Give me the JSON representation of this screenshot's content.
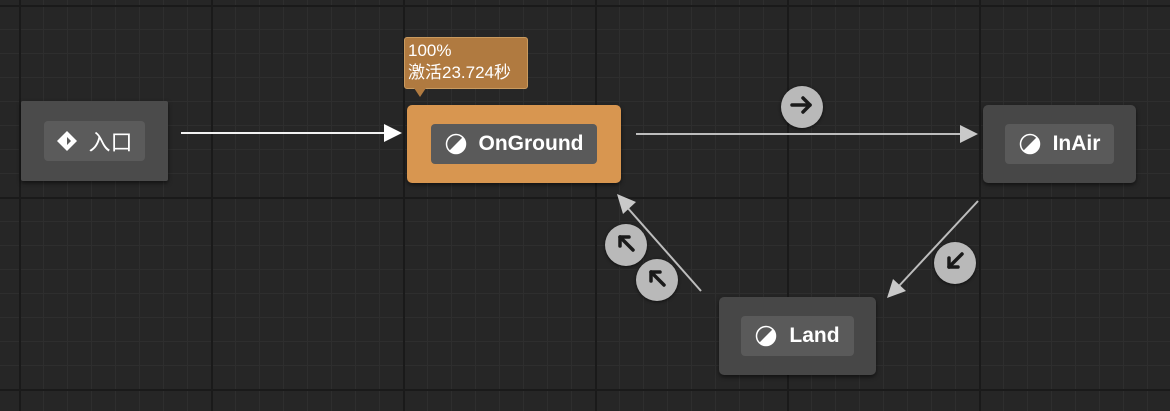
{
  "graph": {
    "entry_node": {
      "label": "入口",
      "icon": "entry-diamond-icon"
    },
    "states": [
      {
        "id": "onground",
        "label": "OnGround",
        "icon": "state-icon",
        "active": true
      },
      {
        "id": "inair",
        "label": "InAir",
        "icon": "state-icon",
        "active": false
      },
      {
        "id": "land",
        "label": "Land",
        "icon": "state-icon",
        "active": false
      }
    ],
    "active_tooltip": {
      "weight": "100%",
      "duration": "激活23.724秒"
    },
    "transitions": [
      {
        "from": "onground",
        "to": "inair",
        "icon": "arrow-right-icon"
      },
      {
        "from": "inair",
        "to": "land",
        "icon": "arrow-down-left-icon"
      },
      {
        "from": "land",
        "to": "onground",
        "icon": "arrow-up-left-icon"
      },
      {
        "from": "land",
        "to": "onground",
        "icon": "arrow-up-left-icon"
      }
    ]
  },
  "colors": {
    "background": "#262626",
    "active_state": "#d89650",
    "state_node": "#474747",
    "tooltip": "#b07a40",
    "transition_button": "#b9b9b9",
    "wire": "#bdbdbd"
  }
}
